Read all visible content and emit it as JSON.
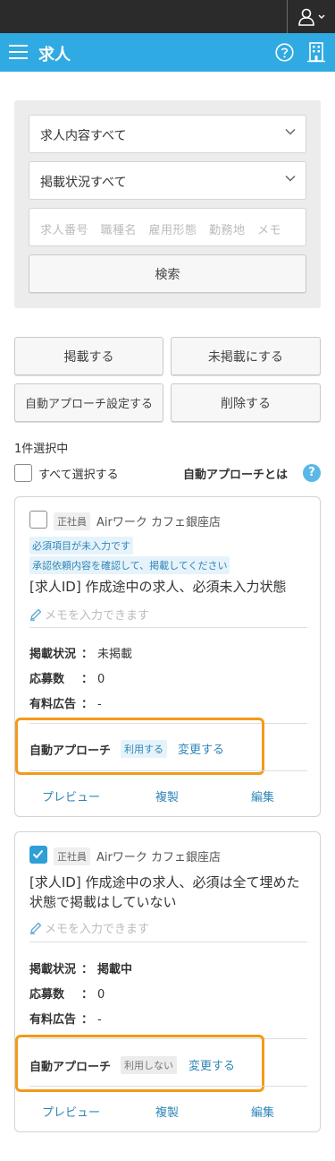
{
  "header": {
    "title": "求人"
  },
  "search": {
    "content_select": "求人内容すべて",
    "status_select": "掲載状況すべて",
    "keyword_placeholder": "求人番号　職種名　雇用形態　勤務地　メモ",
    "search_button": "検索"
  },
  "actions": {
    "publish": "掲載する",
    "unpublish": "未掲載にする",
    "auto_approach_settings": "自動アプローチ設定する",
    "delete": "削除する"
  },
  "selection": {
    "count": "1件選択中",
    "select_all": "すべて選択する",
    "auto_approach_link": "自動アプローチとは",
    "help_mark": "?"
  },
  "cards": [
    {
      "checked": false,
      "employment": "正社員",
      "company": "Airワーク カフェ銀座店",
      "warnings": [
        "必須項目が未入力です",
        "承認依頼内容を確認して、掲載してください"
      ],
      "title": "[求人ID] 作成途中の求人、必須未入力状態",
      "memo": "メモを入力できます",
      "status_label": "掲載状況",
      "status_value": "未掲載",
      "applicants_label": "応募数",
      "applicants_value": "0",
      "paid_ad_label": "有料広告",
      "paid_ad_value": "-",
      "colon": "：",
      "auto_approach_label": "自動アプローチ",
      "auto_approach_state": "利用する",
      "change": "変更する",
      "preview": "プレビュー",
      "duplicate": "複製",
      "edit": "編集"
    },
    {
      "checked": true,
      "employment": "正社員",
      "company": "Airワーク カフェ銀座店",
      "title": "[求人ID] 作成途中の求人、必須は全て埋めた状態で掲載はしていない",
      "memo": "メモを入力できます",
      "status_label": "掲載状況",
      "status_value": "掲載中",
      "applicants_label": "応募数",
      "applicants_value": "0",
      "paid_ad_label": "有料広告",
      "paid_ad_value": "-",
      "colon": "：",
      "auto_approach_label": "自動アプローチ",
      "auto_approach_state": "利用しない",
      "change": "変更する",
      "preview": "プレビュー",
      "duplicate": "複製",
      "edit": "編集"
    }
  ],
  "colors": {
    "header": "#30aae2",
    "accent": "#2f86b9",
    "highlight": "#f39a1b",
    "topbar": "#2b2b2b"
  }
}
